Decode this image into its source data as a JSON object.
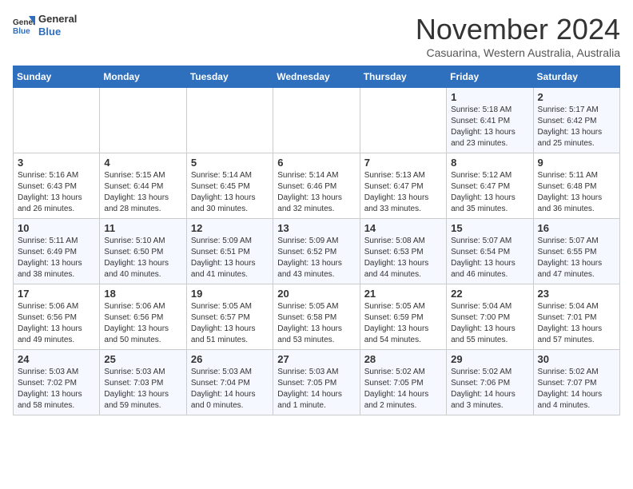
{
  "logo": {
    "line1": "General",
    "line2": "Blue"
  },
  "title": "November 2024",
  "location": "Casuarina, Western Australia, Australia",
  "days_of_week": [
    "Sunday",
    "Monday",
    "Tuesday",
    "Wednesday",
    "Thursday",
    "Friday",
    "Saturday"
  ],
  "weeks": [
    [
      {
        "day": "",
        "data": ""
      },
      {
        "day": "",
        "data": ""
      },
      {
        "day": "",
        "data": ""
      },
      {
        "day": "",
        "data": ""
      },
      {
        "day": "",
        "data": ""
      },
      {
        "day": "1",
        "data": "Sunrise: 5:18 AM\nSunset: 6:41 PM\nDaylight: 13 hours\nand 23 minutes."
      },
      {
        "day": "2",
        "data": "Sunrise: 5:17 AM\nSunset: 6:42 PM\nDaylight: 13 hours\nand 25 minutes."
      }
    ],
    [
      {
        "day": "3",
        "data": "Sunrise: 5:16 AM\nSunset: 6:43 PM\nDaylight: 13 hours\nand 26 minutes."
      },
      {
        "day": "4",
        "data": "Sunrise: 5:15 AM\nSunset: 6:44 PM\nDaylight: 13 hours\nand 28 minutes."
      },
      {
        "day": "5",
        "data": "Sunrise: 5:14 AM\nSunset: 6:45 PM\nDaylight: 13 hours\nand 30 minutes."
      },
      {
        "day": "6",
        "data": "Sunrise: 5:14 AM\nSunset: 6:46 PM\nDaylight: 13 hours\nand 32 minutes."
      },
      {
        "day": "7",
        "data": "Sunrise: 5:13 AM\nSunset: 6:47 PM\nDaylight: 13 hours\nand 33 minutes."
      },
      {
        "day": "8",
        "data": "Sunrise: 5:12 AM\nSunset: 6:47 PM\nDaylight: 13 hours\nand 35 minutes."
      },
      {
        "day": "9",
        "data": "Sunrise: 5:11 AM\nSunset: 6:48 PM\nDaylight: 13 hours\nand 36 minutes."
      }
    ],
    [
      {
        "day": "10",
        "data": "Sunrise: 5:11 AM\nSunset: 6:49 PM\nDaylight: 13 hours\nand 38 minutes."
      },
      {
        "day": "11",
        "data": "Sunrise: 5:10 AM\nSunset: 6:50 PM\nDaylight: 13 hours\nand 40 minutes."
      },
      {
        "day": "12",
        "data": "Sunrise: 5:09 AM\nSunset: 6:51 PM\nDaylight: 13 hours\nand 41 minutes."
      },
      {
        "day": "13",
        "data": "Sunrise: 5:09 AM\nSunset: 6:52 PM\nDaylight: 13 hours\nand 43 minutes."
      },
      {
        "day": "14",
        "data": "Sunrise: 5:08 AM\nSunset: 6:53 PM\nDaylight: 13 hours\nand 44 minutes."
      },
      {
        "day": "15",
        "data": "Sunrise: 5:07 AM\nSunset: 6:54 PM\nDaylight: 13 hours\nand 46 minutes."
      },
      {
        "day": "16",
        "data": "Sunrise: 5:07 AM\nSunset: 6:55 PM\nDaylight: 13 hours\nand 47 minutes."
      }
    ],
    [
      {
        "day": "17",
        "data": "Sunrise: 5:06 AM\nSunset: 6:56 PM\nDaylight: 13 hours\nand 49 minutes."
      },
      {
        "day": "18",
        "data": "Sunrise: 5:06 AM\nSunset: 6:56 PM\nDaylight: 13 hours\nand 50 minutes."
      },
      {
        "day": "19",
        "data": "Sunrise: 5:05 AM\nSunset: 6:57 PM\nDaylight: 13 hours\nand 51 minutes."
      },
      {
        "day": "20",
        "data": "Sunrise: 5:05 AM\nSunset: 6:58 PM\nDaylight: 13 hours\nand 53 minutes."
      },
      {
        "day": "21",
        "data": "Sunrise: 5:05 AM\nSunset: 6:59 PM\nDaylight: 13 hours\nand 54 minutes."
      },
      {
        "day": "22",
        "data": "Sunrise: 5:04 AM\nSunset: 7:00 PM\nDaylight: 13 hours\nand 55 minutes."
      },
      {
        "day": "23",
        "data": "Sunrise: 5:04 AM\nSunset: 7:01 PM\nDaylight: 13 hours\nand 57 minutes."
      }
    ],
    [
      {
        "day": "24",
        "data": "Sunrise: 5:03 AM\nSunset: 7:02 PM\nDaylight: 13 hours\nand 58 minutes."
      },
      {
        "day": "25",
        "data": "Sunrise: 5:03 AM\nSunset: 7:03 PM\nDaylight: 13 hours\nand 59 minutes."
      },
      {
        "day": "26",
        "data": "Sunrise: 5:03 AM\nSunset: 7:04 PM\nDaylight: 14 hours\nand 0 minutes."
      },
      {
        "day": "27",
        "data": "Sunrise: 5:03 AM\nSunset: 7:05 PM\nDaylight: 14 hours\nand 1 minute."
      },
      {
        "day": "28",
        "data": "Sunrise: 5:02 AM\nSunset: 7:05 PM\nDaylight: 14 hours\nand 2 minutes."
      },
      {
        "day": "29",
        "data": "Sunrise: 5:02 AM\nSunset: 7:06 PM\nDaylight: 14 hours\nand 3 minutes."
      },
      {
        "day": "30",
        "data": "Sunrise: 5:02 AM\nSunset: 7:07 PM\nDaylight: 14 hours\nand 4 minutes."
      }
    ]
  ]
}
